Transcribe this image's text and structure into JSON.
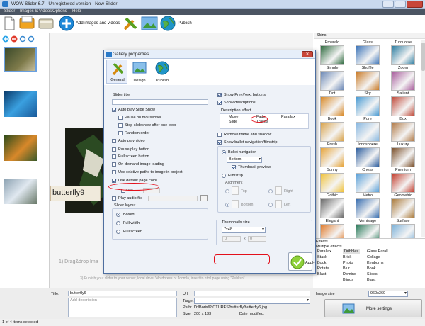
{
  "window": {
    "title": "WOW Slider 6.7 - Unregistered version - New Slider"
  },
  "menu": [
    "Slider",
    "Images & Videos",
    "Options",
    "Help"
  ],
  "toolbar": {
    "add_label": "Add images and videos",
    "publish_label": "Publish"
  },
  "preview": {
    "caption": "butterfly9",
    "hint1": "1) Drag&drop Ima",
    "hint2": "3) Publish your slider to your server, local drive, Wordpress or Joomla, insert to html page using \"Publish\""
  },
  "skins": {
    "header": "Skins",
    "items": [
      "Emerald",
      "Glass",
      "Turquoise",
      "Simple",
      "Shuffle",
      "Zoom",
      "Dot",
      "Sky",
      "Salient",
      "Book",
      "Pure",
      "Box",
      "Fresh",
      "Ionosphere",
      "Luxury",
      "Sunny",
      "Chess",
      "Premium",
      "Gothic",
      "Metro",
      "Geometric",
      "Elegant",
      "Vernisage",
      "Surface"
    ],
    "colors": [
      "#2f6b3f",
      "#3c74b8",
      "#2b7ca0",
      "#6a87b5",
      "#c97a26",
      "#a65a9a",
      "#d88a2a",
      "#4a9bd3",
      "#c04a3a",
      "#d8a24a",
      "#87b7e0",
      "#b07844",
      "#e6a43a",
      "#2e5e9e",
      "#7a4f2a",
      "#f0c23a",
      "#5aa0d8",
      "#c23a2a",
      "#6b6b6b",
      "#3a6fb0",
      "#aa7a3a",
      "#e07a2a",
      "#2a7a5a",
      "#7ab0d8"
    ]
  },
  "effects": {
    "header": "Effects",
    "subheader": "Multiple effects",
    "col1": [
      "Parallax",
      "Stack",
      "Book",
      "Rotate",
      "Blast"
    ],
    "col2": [
      "Dribbles",
      "Brick",
      "Photo",
      "Blur",
      "Domino",
      "Blinds"
    ],
    "col3": [
      "Glass Parall...",
      "Collage",
      "Kenburns",
      "Book",
      "Slices",
      "Blast"
    ]
  },
  "bottom": {
    "title_label": "Title:",
    "title_value": "butterfly6",
    "desc_placeholder": "Add description",
    "url_label": "Url:",
    "target_label": "Target",
    "path_label": "Path:",
    "path_value": "D:/Boris/PICTURES/butterfly/butterfly6.jpg",
    "size_label": "Size:",
    "size_value": "200 x 133",
    "date_label": "Date modified:",
    "image_size_label": "Image size",
    "image_size_value": "960x360",
    "more_settings": "More settings"
  },
  "status": {
    "text": "1 of 4 items selected"
  },
  "dialog": {
    "title": "Gallery properties",
    "tabs": [
      "General",
      "Design",
      "Publish"
    ],
    "slider_title_label": "Slider title",
    "slider_title_value": "",
    "left_checks": [
      {
        "label": "Auto play Slide Show",
        "checked": true
      },
      {
        "label": "Pause on mouseover",
        "checked": false
      },
      {
        "label": "Stop slideshow after one loop",
        "checked": false
      },
      {
        "label": "Random order",
        "checked": false
      },
      {
        "label": "Auto play video",
        "checked": false
      },
      {
        "label": "Pause/play button",
        "checked": false
      },
      {
        "label": "Full screen button",
        "checked": false
      },
      {
        "label": "On-demand image loading",
        "checked": false
      },
      {
        "label": "Use relative paths to image in project",
        "checked": false
      },
      {
        "label": "Use default page color",
        "checked": true
      }
    ],
    "hex_label": "Hex",
    "audio_label": "Play audio file",
    "audio_btn": "...",
    "layout_label": "Slider layout",
    "layout_options": [
      "Boxed",
      "Full width",
      "Full screen"
    ],
    "layout_selected": 0,
    "right_checks": [
      {
        "label": "Show Prev/Next buttons",
        "checked": true
      },
      {
        "label": "Show descriptions",
        "checked": true
      }
    ],
    "desc_effect_label": "Description effect",
    "desc_effects": [
      "Move",
      "Fade",
      "Parallax",
      "Slide",
      "Traces"
    ],
    "right_checks2": [
      {
        "label": "Remove frame and shadow",
        "checked": false
      },
      {
        "label": "Show bullet navigation/filmstrip",
        "checked": true
      }
    ],
    "bullet_label": "Bullet navigation",
    "bullet_pos": "Bottom",
    "thumb_preview_label": "Thumbnail preview",
    "filmstrip_label": "Filmstrip",
    "alignment_label": "Alignment",
    "align_options": [
      "Top",
      "Right",
      "Bottom",
      "Left"
    ],
    "thumb_size_label": "Thumbnails size",
    "thumb_size_value": "7x48",
    "spin1": "0",
    "x_label": "x",
    "spin2": "0",
    "apply_label": "Apply"
  },
  "colors": {
    "annotation": "#e3101b",
    "titlebar": "#c9d9ee",
    "accent": "#2a79c8",
    "apply_green": "#8fd13a"
  }
}
